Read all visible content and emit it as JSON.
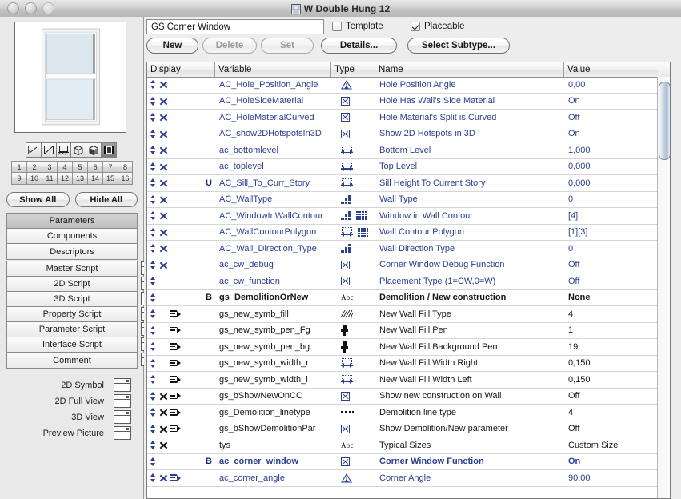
{
  "window": {
    "title": "W Double Hung 12",
    "doc_icon": "document-icon",
    "buttons": [
      "close-button",
      "minimize-button",
      "zoom-button"
    ]
  },
  "preview": {
    "label": "window-preview-thumbnail",
    "view_icons": [
      "line-view-icon",
      "symbol-view-icon",
      "section-view-icon",
      "wireframe-3d-icon",
      "solid-3d-icon",
      "film-preview-icon"
    ],
    "selected_view_index": 5
  },
  "layers": {
    "numbers": [
      "1",
      "2",
      "3",
      "4",
      "5",
      "6",
      "7",
      "8",
      "9",
      "10",
      "11",
      "12",
      "13",
      "14",
      "15",
      "16"
    ],
    "show_all": "Show All",
    "hide_all": "Hide All"
  },
  "nav": {
    "primary": [
      {
        "label": "Parameters",
        "selected": true
      },
      {
        "label": "Components",
        "selected": false
      },
      {
        "label": "Descriptors",
        "selected": false
      }
    ],
    "scripts": [
      {
        "label": "Master Script"
      },
      {
        "label": "2D Script"
      },
      {
        "label": "3D Script"
      },
      {
        "label": "Property Script"
      },
      {
        "label": "Parameter Script"
      },
      {
        "label": "Interface Script"
      },
      {
        "label": "Comment"
      }
    ],
    "views": [
      {
        "label": "2D Symbol"
      },
      {
        "label": "2D Full View"
      },
      {
        "label": "3D View"
      },
      {
        "label": "Preview Picture"
      }
    ]
  },
  "toolbar": {
    "name_value": "GS Corner Window",
    "template_label": "Template",
    "template_checked": false,
    "placeable_label": "Placeable",
    "placeable_checked": true,
    "new_label": "New",
    "delete_label": "Delete",
    "set_label": "Set",
    "details_label": "Details...",
    "select_subtype_label": "Select Subtype..."
  },
  "table": {
    "columns": [
      "Display",
      "Variable",
      "Type",
      "Name",
      "Value"
    ],
    "rows": [
      {
        "updown": true,
        "x": true,
        "child": false,
        "flag": "",
        "variable": "AC_Hole_Position_Angle",
        "type": "angle",
        "array": false,
        "name": "Hole Position Angle",
        "value": "0,00",
        "style": "blue"
      },
      {
        "updown": true,
        "x": true,
        "child": false,
        "flag": "",
        "variable": "AC_HoleSideMaterial",
        "type": "bool",
        "array": false,
        "name": "Hole Has Wall's Side Material",
        "value": "On",
        "style": "blue"
      },
      {
        "updown": true,
        "x": true,
        "child": false,
        "flag": "",
        "variable": "AC_HoleMaterialCurved",
        "type": "bool",
        "array": false,
        "name": "Hole Material's Split is Curved",
        "value": "Off",
        "style": "blue"
      },
      {
        "updown": true,
        "x": true,
        "child": false,
        "flag": "",
        "variable": "AC_show2DHotspotsIn3D",
        "type": "bool",
        "array": false,
        "name": "Show 2D Hotspots in 3D",
        "value": "On",
        "style": "blue"
      },
      {
        "updown": true,
        "x": true,
        "child": false,
        "flag": "",
        "variable": "ac_bottomlevel",
        "type": "length",
        "array": false,
        "name": "Bottom Level",
        "value": "1,000",
        "style": "blue"
      },
      {
        "updown": true,
        "x": true,
        "child": false,
        "flag": "",
        "variable": "ac_toplevel",
        "type": "length",
        "array": false,
        "name": "Top Level",
        "value": "0,000",
        "style": "blue"
      },
      {
        "updown": true,
        "x": true,
        "child": false,
        "flag": "U",
        "variable": "AC_Sill_To_Curr_Story",
        "type": "length",
        "array": false,
        "name": "Sill Height To Current Story",
        "value": "0,000",
        "style": "blue"
      },
      {
        "updown": true,
        "x": true,
        "child": false,
        "flag": "",
        "variable": "AC_WallType",
        "type": "int",
        "array": false,
        "name": "Wall Type",
        "value": "0",
        "style": "blue"
      },
      {
        "updown": true,
        "x": true,
        "child": false,
        "flag": "",
        "variable": "AC_WindowInWallContour",
        "type": "int",
        "array": true,
        "name": "Window in Wall Contour",
        "value": "[4]",
        "style": "blue"
      },
      {
        "updown": true,
        "x": true,
        "child": false,
        "flag": "",
        "variable": "AC_WallContourPolygon",
        "type": "length",
        "array": true,
        "name": "Wall Contour Polygon",
        "value": "[1][3]",
        "style": "blue"
      },
      {
        "updown": true,
        "x": true,
        "child": false,
        "flag": "",
        "variable": "AC_Wall_Direction_Type",
        "type": "int",
        "array": false,
        "name": "Wall Direction Type",
        "value": "0",
        "style": "blue"
      },
      {
        "updown": true,
        "x": true,
        "child": false,
        "flag": "",
        "variable": "ac_cw_debug",
        "type": "bool",
        "array": false,
        "name": "Corner Window Debug Function",
        "value": "Off",
        "style": "blue"
      },
      {
        "updown": true,
        "x": false,
        "child": false,
        "flag": "",
        "variable": "ac_cw_function",
        "type": "bool",
        "array": false,
        "name": "Placement Type (1=CW,0=W)",
        "value": "Off",
        "style": "blue"
      },
      {
        "updown": true,
        "x": false,
        "child": false,
        "flag": "B",
        "variable": "gs_DemolitionOrNew",
        "type": "abc",
        "array": false,
        "name": "Demolition / New construction",
        "value": "None",
        "style": "dark-bold"
      },
      {
        "updown": true,
        "x": false,
        "child": true,
        "flag": "",
        "variable": "gs_new_symb_fill",
        "type": "fill",
        "array": false,
        "name": "New Wall Fill Type",
        "value": "4",
        "style": "dark"
      },
      {
        "updown": true,
        "x": false,
        "child": true,
        "flag": "",
        "variable": "gs_new_symb_pen_Fg",
        "type": "pen",
        "array": false,
        "name": "New Wall Fill Pen",
        "value": "1",
        "style": "dark"
      },
      {
        "updown": true,
        "x": false,
        "child": true,
        "flag": "",
        "variable": "gs_new_symb_pen_bg",
        "type": "pen",
        "array": false,
        "name": "New Wall Fill Background Pen",
        "value": "19",
        "style": "dark"
      },
      {
        "updown": true,
        "x": false,
        "child": true,
        "flag": "",
        "variable": "gs_new_symb_width_r",
        "type": "length",
        "array": false,
        "name": "New Wall Fill Width Right",
        "value": "0,150",
        "style": "dark"
      },
      {
        "updown": true,
        "x": false,
        "child": true,
        "flag": "",
        "variable": "gs_new_symb_width_l",
        "type": "length",
        "array": false,
        "name": "New Wall Fill Width Left",
        "value": "0,150",
        "style": "dark"
      },
      {
        "updown": true,
        "x": true,
        "child": true,
        "flag": "",
        "variable": "gs_bShowNewOnCC",
        "type": "bool",
        "array": false,
        "name": "Show new construction on Wall",
        "value": "Off",
        "style": "dark"
      },
      {
        "updown": true,
        "x": true,
        "child": true,
        "flag": "",
        "variable": "gs_Demolition_linetype",
        "type": "line",
        "array": false,
        "name": "Demolition line type",
        "value": "4",
        "style": "dark"
      },
      {
        "updown": true,
        "x": true,
        "child": true,
        "flag": "",
        "variable": "gs_bShowDemolitionPar",
        "type": "bool",
        "array": false,
        "name": "Show Demolition/New parameter",
        "value": "Off",
        "style": "dark"
      },
      {
        "updown": true,
        "x": true,
        "child": false,
        "flag": "",
        "variable": "tys",
        "type": "abc",
        "array": false,
        "name": "Typical Sizes",
        "value": "Custom Size",
        "style": "dark"
      },
      {
        "updown": true,
        "x": false,
        "child": false,
        "flag": "B",
        "variable": "ac_corner_window",
        "type": "bool",
        "array": false,
        "name": "Corner Window Function",
        "value": "On",
        "style": "blue-bold"
      },
      {
        "updown": true,
        "x": true,
        "child": true,
        "flag": "",
        "variable": "ac_corner_angle",
        "type": "angle",
        "array": false,
        "name": "Corner Angle",
        "value": "90,00",
        "style": "blue"
      }
    ]
  },
  "scrollbar": {
    "name": "vertical-scrollbar"
  },
  "colors": {
    "blue_text": "#2b3f93",
    "dark_text": "#181818",
    "titlebar": "#c8c8c8",
    "panel_bg": "#e9e9e9"
  }
}
